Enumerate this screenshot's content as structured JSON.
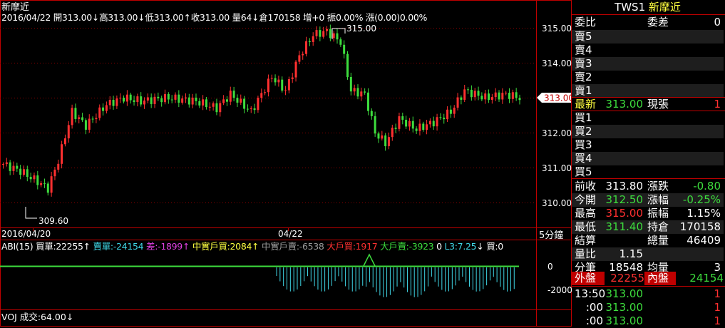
{
  "info_line": {
    "title": "新摩近",
    "items": [
      {
        "text": "2016/04/22",
        "color": "#ffffff"
      },
      {
        "text": "開313.00",
        "color": "#ffffff"
      },
      {
        "text": "↓",
        "color": "#ffffff"
      },
      {
        "text": "高313.00",
        "color": "#ffffff"
      },
      {
        "text": "↓",
        "color": "#ffffff"
      },
      {
        "text": "低313.00",
        "color": "#ffffff"
      },
      {
        "text": "↑",
        "color": "#ffffff"
      },
      {
        "text": "收313.00",
        "color": "#ffffff"
      },
      {
        "text": "量64",
        "color": "#ffffff"
      },
      {
        "text": "↓",
        "color": "#ffffff"
      },
      {
        "text": "倉170158",
        "color": "#ffffff"
      },
      {
        "text": "增+0",
        "color": "#ffffff"
      },
      {
        "text": "振0.00%",
        "color": "#ffffff"
      },
      {
        "text": "漲(0.00)0.00%",
        "color": "#ffffff"
      }
    ]
  },
  "price_axis": {
    "ticks": [
      "315.00",
      "314.00",
      "313.00",
      "312.00",
      "311.00",
      "310.00"
    ],
    "current_price_tag": "313.00"
  },
  "date_axis": {
    "labels": [
      "2016/04/20",
      "04/22"
    ],
    "period": "5分鐘"
  },
  "annotations": {
    "high": "315.00",
    "low": "309.60"
  },
  "indicator_line": {
    "items": [
      {
        "text": "ABI(15)",
        "color": "#ffffff"
      },
      {
        "text": "買單:22255",
        "color": "#ffffff"
      },
      {
        "text": "↑",
        "color": "#ffffff"
      },
      {
        "text": "賣單:-24154",
        "color": "#3fd6e6"
      },
      {
        "text": "差:-1899",
        "color": "#e040e0"
      },
      {
        "text": "↑",
        "color": "#e040e0"
      },
      {
        "text": "中實戶買:2084",
        "color": "#ffff40"
      },
      {
        "text": "↑",
        "color": "#ffff40"
      },
      {
        "text": "中實戶賣:-6538",
        "color": "#9a9a9a"
      },
      {
        "text": "大戶買:1917",
        "color": "#ff3030"
      },
      {
        "text": "大戶賣:-3923",
        "color": "#3ddc3d"
      },
      {
        "text": "0",
        "color": "#ffffff"
      },
      {
        "text": "L3:7.25",
        "color": "#3fd6e6"
      },
      {
        "text": "↓",
        "color": "#ffffff"
      },
      {
        "text": "買:0",
        "color": "#ffffff"
      }
    ],
    "axis_ticks": [
      "0",
      "-2000"
    ]
  },
  "volume_line": {
    "text": "VOJ 成交:64.00",
    "arrow": "↓"
  },
  "quote_panel": {
    "symbol": "TWS1",
    "name": "新摩近",
    "ratio_label": "委比",
    "diff_label": "委差",
    "diff_value": "0",
    "asks": [
      "賣5",
      "賣4",
      "賣3",
      "賣2",
      "賣1"
    ],
    "last_label": "最新",
    "last_value": "313.00",
    "current_vol_label": "現張",
    "current_vol_value": "1",
    "bids": [
      "買1",
      "買2",
      "買3",
      "買4",
      "買5"
    ],
    "stats": [
      {
        "l1": "前收",
        "v1": "313.80",
        "c1": "#ffffff",
        "l2": "漲跌",
        "v2": "-0.80",
        "c2": "#3ddc3d",
        "alt": false
      },
      {
        "l1": "今開",
        "v1": "312.50",
        "c1": "#3ddc3d",
        "l2": "漲幅",
        "v2": "-0.25%",
        "c2": "#3ddc3d",
        "alt": true
      },
      {
        "l1": "最高",
        "v1": "315.00",
        "c1": "#ff3030",
        "l2": "振幅",
        "v2": "1.15%",
        "c2": "#ffffff",
        "alt": false
      },
      {
        "l1": "最低",
        "v1": "311.40",
        "c1": "#3ddc3d",
        "l2": "持倉",
        "v2": "170158",
        "c2": "#ffffff",
        "alt": true
      },
      {
        "l1": "結算",
        "v1": "",
        "c1": "#ffffff",
        "l2": "總量",
        "v2": "46409",
        "c2": "#ffffff",
        "alt": false
      },
      {
        "l1": "量比",
        "v1": "1.15",
        "c1": "#ffffff",
        "l2": "",
        "v2": "",
        "c2": "#ffffff",
        "alt": true
      },
      {
        "l1": "分筆",
        "v1": "18548",
        "c1": "#ffffff",
        "l2": "均量",
        "v2": "3",
        "c2": "#ffffff",
        "alt": false
      }
    ],
    "outer_label": "外盤",
    "outer_value": "22255",
    "inner_label": "內盤",
    "inner_value": "24154",
    "ticks": [
      {
        "time": "13:50",
        "price": "313.00",
        "vol": "1"
      },
      {
        "time": ":00",
        "price": "313.00",
        "vol": "1"
      },
      {
        "time": ":00",
        "price": "313.00",
        "vol": "1"
      }
    ]
  },
  "colors": {
    "up": "#ff3030",
    "down": "#3ddc3d",
    "grid": "#8a0000",
    "frame": "#c00000",
    "abi_bar": "#3fd6e6",
    "accent_yellow": "#ffff40"
  }
}
